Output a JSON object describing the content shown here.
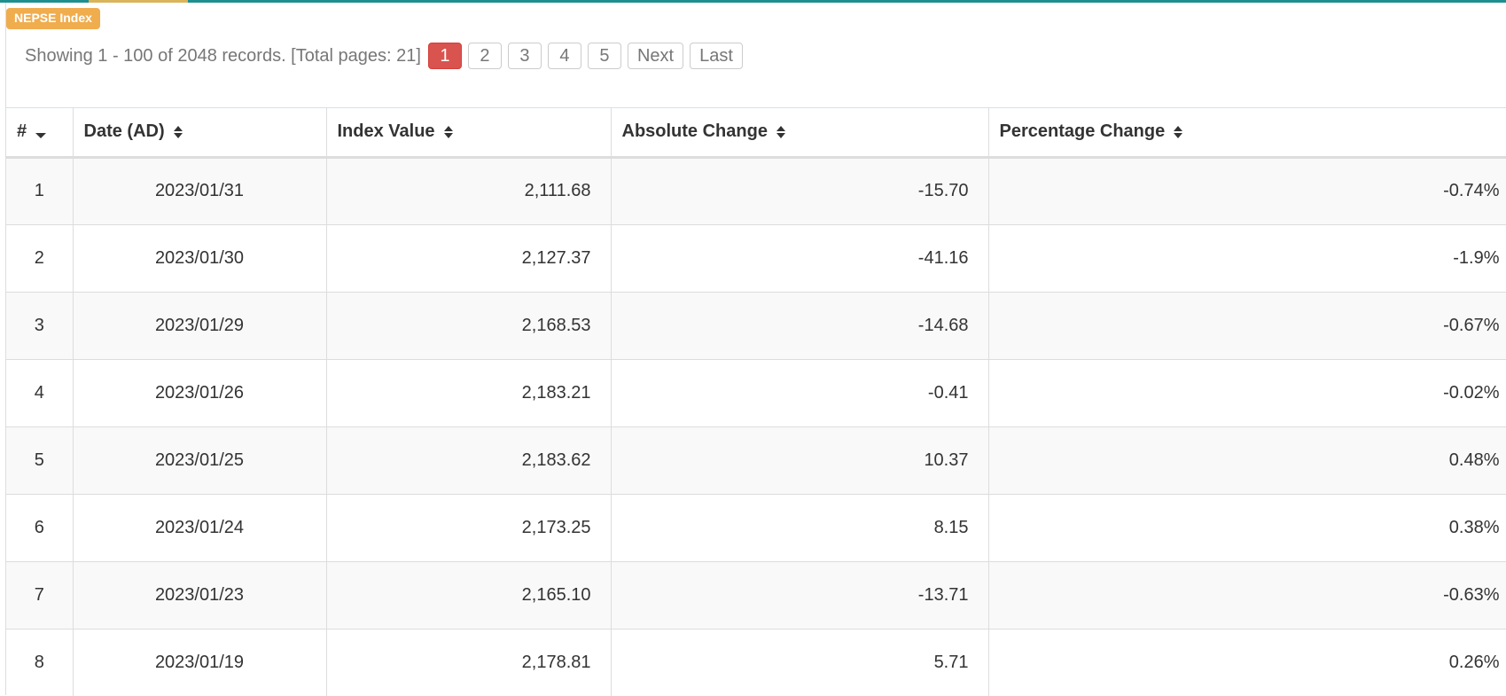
{
  "widget": {
    "title": "NEPSE Index"
  },
  "pagination": {
    "info": "Showing 1 - 100 of 2048 records. [Total pages: 21]",
    "pages": [
      "1",
      "2",
      "3",
      "4",
      "5"
    ],
    "active_page": "1",
    "next_label": "Next",
    "last_label": "Last"
  },
  "table": {
    "headers": {
      "num": "#",
      "date": "Date (AD)",
      "index_value": "Index Value",
      "absolute_change": "Absolute Change",
      "percentage_change": "Percentage Change"
    },
    "sorted_column": "num",
    "sort_direction": "desc",
    "rows": [
      {
        "num": "1",
        "date": "2023/01/31",
        "index_value": "2,111.68",
        "absolute_change": "-15.70",
        "percentage_change": "-0.74%"
      },
      {
        "num": "2",
        "date": "2023/01/30",
        "index_value": "2,127.37",
        "absolute_change": "-41.16",
        "percentage_change": "-1.9%"
      },
      {
        "num": "3",
        "date": "2023/01/29",
        "index_value": "2,168.53",
        "absolute_change": "-14.68",
        "percentage_change": "-0.67%"
      },
      {
        "num": "4",
        "date": "2023/01/26",
        "index_value": "2,183.21",
        "absolute_change": "-0.41",
        "percentage_change": "-0.02%"
      },
      {
        "num": "5",
        "date": "2023/01/25",
        "index_value": "2,183.62",
        "absolute_change": "10.37",
        "percentage_change": "0.48%"
      },
      {
        "num": "6",
        "date": "2023/01/24",
        "index_value": "2,173.25",
        "absolute_change": "8.15",
        "percentage_change": "0.38%"
      },
      {
        "num": "7",
        "date": "2023/01/23",
        "index_value": "2,165.10",
        "absolute_change": "-13.71",
        "percentage_change": "-0.63%"
      },
      {
        "num": "8",
        "date": "2023/01/19",
        "index_value": "2,178.81",
        "absolute_change": "5.71",
        "percentage_change": "0.26%"
      }
    ]
  },
  "colors": {
    "badge": "#f0ad4e",
    "active_page": "#d9534f",
    "accent_bar": "#1e8f8f"
  }
}
